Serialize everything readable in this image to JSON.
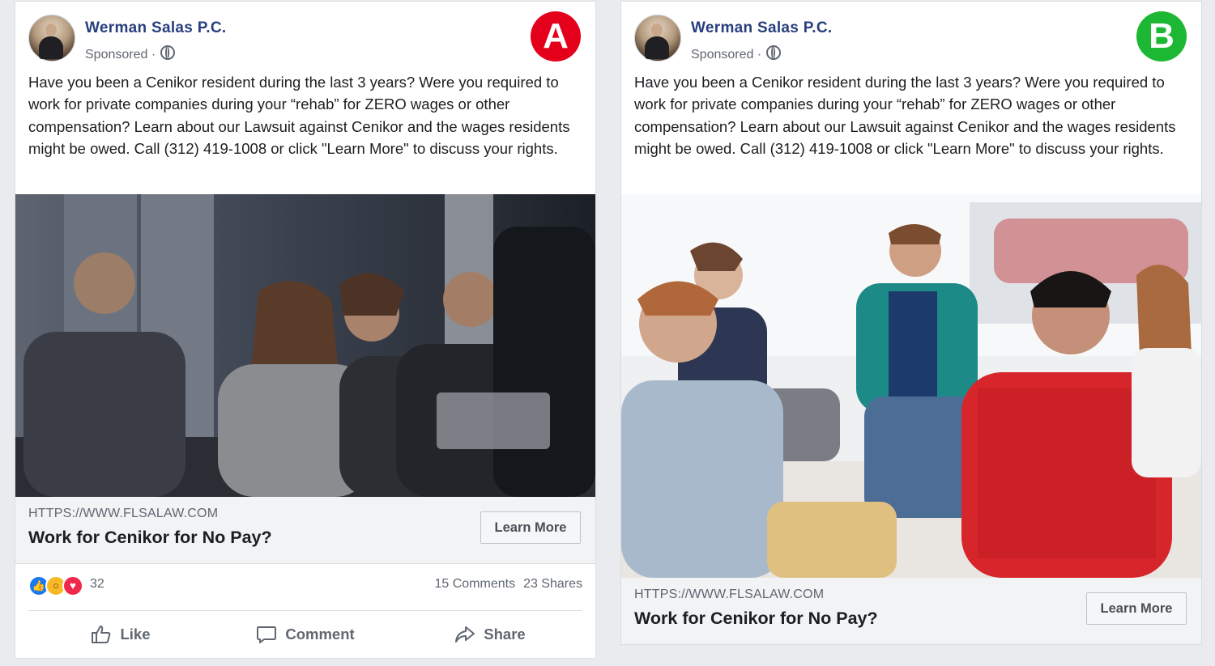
{
  "cards": [
    {
      "variant_label": "A",
      "page_name": "Werman Salas P.C.",
      "sponsored_label": "Sponsored ·",
      "body_text": "Have you been a Cenikor resident during the last 3 years? Were you required to work for private companies during your “rehab” for ZERO wages or other compensation? Learn about our Lawsuit against Cenikor and the wages residents might be owed. Call (312) 419-1008 or click \"Learn More\" to discuss your rights.",
      "link_url": "HTTPS://WWW.FLSALAW.COM",
      "link_title": "Work for Cenikor for No Pay?",
      "cta_label": "Learn More",
      "reaction_count": "32",
      "comments_label": "15 Comments",
      "shares_label": "23 Shares",
      "actions": {
        "like": "Like",
        "comment": "Comment",
        "share": "Share"
      }
    },
    {
      "variant_label": "B",
      "page_name": "Werman Salas P.C.",
      "sponsored_label": "Sponsored ·",
      "body_text": "Have you been a Cenikor resident during the last 3 years? Were you required to work for private companies during your “rehab” for ZERO wages or other compensation? Learn about our Lawsuit against Cenikor and the wages residents might be owed. Call (312) 419-1008 or click \"Learn More\" to discuss your rights.",
      "link_url": "HTTPS://WWW.FLSALAW.COM",
      "link_title": "Work for Cenikor for No Pay?",
      "cta_label": "Learn More"
    }
  ],
  "colors": {
    "page_name": "#283f7e",
    "badge_a": "#e4001b",
    "badge_b": "#1db833",
    "like": "#1877f2",
    "wow": "#f7b928",
    "love": "#f0284a"
  },
  "icons": [
    "globe-icon",
    "thumbs-up-icon",
    "comment-icon",
    "share-arrow-icon",
    "like-reaction-icon",
    "wow-reaction-icon",
    "love-reaction-icon"
  ]
}
